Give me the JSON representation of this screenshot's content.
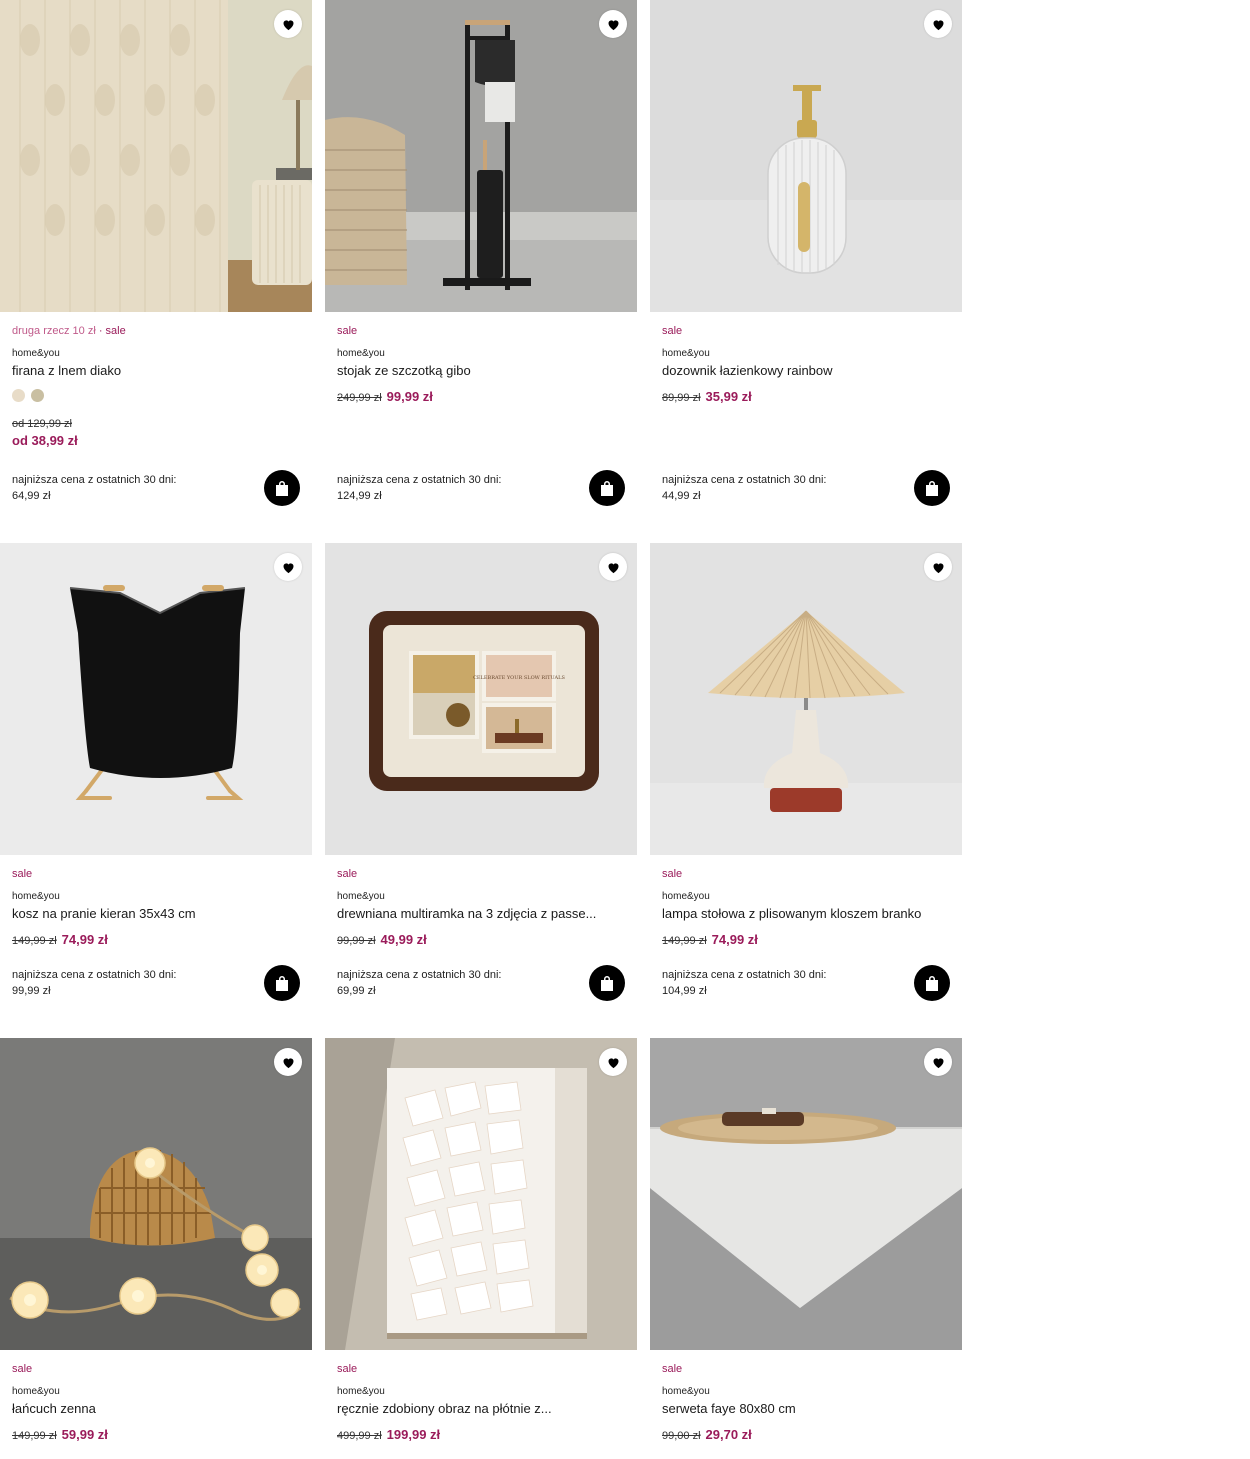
{
  "colors": {
    "sale": "#9a1b5a",
    "promo": "#c05a8a",
    "button_dark": "#000000"
  },
  "icons": {
    "favorite": "heart-icon",
    "cart": "shopping-bag-icon"
  },
  "products": [
    {
      "promo": "druga rzecz 10 zł",
      "separator": " · ",
      "badge": "sale",
      "brand": "home&you",
      "name": "firana z lnem diako",
      "swatches": [
        "#e8dcc8",
        "#c9bfa2"
      ],
      "old_price": "od 129,99 zł",
      "new_price": "od 38,99 zł",
      "lowest_label": "najniższa cena z ostatnich 30 dni:",
      "lowest_value": "64,99 zł"
    },
    {
      "badge": "sale",
      "brand": "home&you",
      "name": "stojak ze szczotką gibo",
      "old_price": "249,99 zł",
      "new_price": "99,99 zł",
      "lowest_label": "najniższa cena z ostatnich 30 dni:",
      "lowest_value": "124,99 zł"
    },
    {
      "badge": "sale",
      "brand": "home&you",
      "name": "dozownik łazienkowy rainbow",
      "old_price": "89,99 zł",
      "new_price": "35,99 zł",
      "lowest_label": "najniższa cena z ostatnich 30 dni:",
      "lowest_value": "44,99 zł"
    },
    {
      "badge": "sale",
      "brand": "home&you",
      "name": "kosz na pranie kieran 35x43 cm",
      "old_price": "149,99 zł",
      "new_price": "74,99 zł",
      "lowest_label": "najniższa cena z ostatnich 30 dni:",
      "lowest_value": "99,99 zł"
    },
    {
      "badge": "sale",
      "brand": "home&you",
      "name": "drewniana multiramka na 3 zdjęcia z passe...",
      "old_price": "99,99 zł",
      "new_price": "49,99 zł",
      "lowest_label": "najniższa cena z ostatnich 30 dni:",
      "lowest_value": "69,99 zł",
      "artwork_text": "CELEBRATE YOUR SLOW RITUALS"
    },
    {
      "badge": "sale",
      "brand": "home&you",
      "name": "lampa stołowa z plisowanym kloszem branko",
      "old_price": "149,99 zł",
      "new_price": "74,99 zł",
      "lowest_label": "najniższa cena z ostatnich 30 dni:",
      "lowest_value": "104,99 zł"
    },
    {
      "badge": "sale",
      "brand": "home&you",
      "name": "łańcuch zenna",
      "old_price": "149,99 zł",
      "new_price": "59,99 zł"
    },
    {
      "badge": "sale",
      "brand": "home&you",
      "name": "ręcznie zdobiony obraz na płótnie z...",
      "old_price": "499,99 zł",
      "new_price": "199,99 zł"
    },
    {
      "badge": "sale",
      "brand": "home&you",
      "name": "serweta faye 80x80 cm",
      "old_price": "99,00 zł",
      "new_price": "29,70 zł"
    }
  ]
}
